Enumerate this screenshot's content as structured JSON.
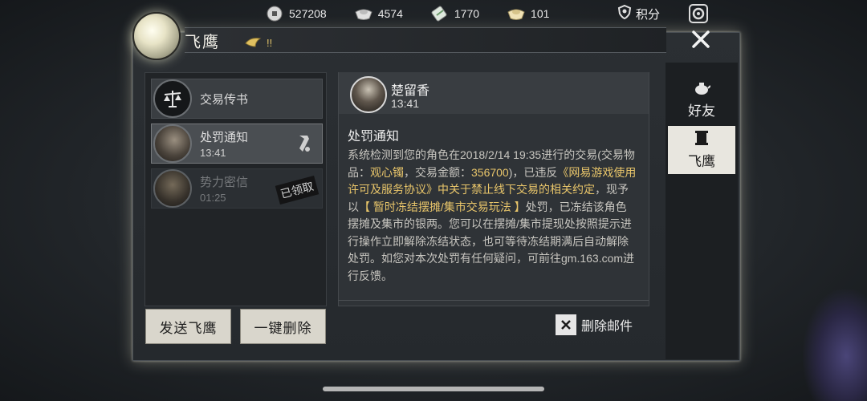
{
  "currencies": [
    {
      "icon": "silver-coin-icon",
      "value": "527208"
    },
    {
      "icon": "silver-ingot-icon",
      "value": "4574"
    },
    {
      "icon": "jade-ticket-icon",
      "value": "1770"
    },
    {
      "icon": "gold-ingot-icon",
      "value": "101"
    }
  ],
  "points": {
    "icon": "points-shield-icon",
    "label": "积分"
  },
  "window": {
    "title": "飞鹰",
    "marquee": "!!"
  },
  "mail_list": [
    {
      "name": "交易传书",
      "time": "",
      "icon": "scale-icon",
      "badge": ""
    },
    {
      "name": "处罚通知",
      "time": "13:41",
      "icon": "",
      "badge": "scroll-icon",
      "selected": true
    },
    {
      "name": "势力密信",
      "time": "01:25",
      "icon": "",
      "badge": "已领取"
    }
  ],
  "buttons": {
    "send": "发送飞鹰",
    "delete_all": "一键删除"
  },
  "mail": {
    "sender": "楚留香",
    "time": "13:41",
    "subject": "处罚通知",
    "body_parts": [
      "系统检测到您的角色在2018/2/14 19:35进行的交易(交易物品：",
      "观心镯",
      "，交易金额：",
      "356700",
      ")，已违反",
      "《网易游戏使用许可及服务协议》中关于禁止线下交易的相关约定",
      "，现予以",
      "【 暂时冻结摆摊/集市交易玩法 】",
      "处罚，已冻结该角色摆摊及集市的银两。您可以在摆摊/集市提现处按照提示进行操作立即解除冻结状态，也可等待冻结期满后自动解除处罚。如您对本次处罚有任何疑问，可前往gm.163.com进行反馈。"
    ],
    "delete_label": "删除邮件"
  },
  "tabs": [
    {
      "label": "好友",
      "icon": "teapot-icon"
    },
    {
      "label": "飞鹰",
      "icon": "scroll-icon",
      "active": true
    }
  ]
}
